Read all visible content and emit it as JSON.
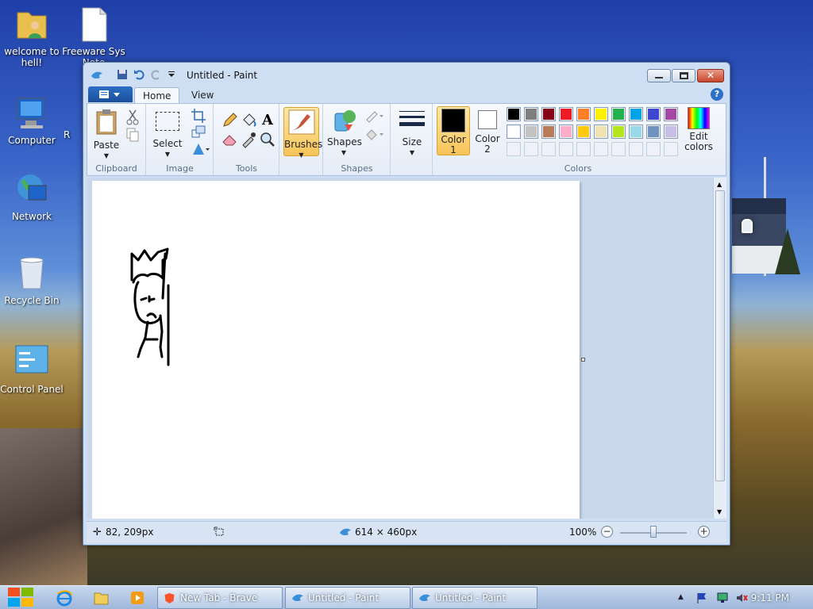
{
  "desktop": {
    "icons": [
      {
        "label": "welcome to hell!"
      },
      {
        "label": "Freeware Sys Note"
      },
      {
        "label": "Computer"
      },
      {
        "label": "R"
      },
      {
        "label": "Network"
      },
      {
        "label": "Recycle Bin"
      },
      {
        "label": "Control Panel"
      }
    ]
  },
  "window": {
    "title": "Untitled - Paint",
    "tabs": {
      "home": "Home",
      "view": "View"
    },
    "ribbon": {
      "clipboard": {
        "label": "Clipboard",
        "paste": "Paste"
      },
      "image": {
        "label": "Image",
        "select": "Select"
      },
      "tools": {
        "label": "Tools"
      },
      "brushes": "Brushes",
      "shapes": {
        "label": "Shapes",
        "button": "Shapes"
      },
      "size": "Size",
      "color1": {
        "line1": "Color",
        "line2": "1",
        "value": "#000000"
      },
      "color2": {
        "line1": "Color",
        "line2": "2",
        "value": "#ffffff"
      },
      "colors": {
        "label": "Colors",
        "edit_line1": "Edit",
        "edit_line2": "colors",
        "palette_row1": [
          "#000000",
          "#7f7f7f",
          "#880015",
          "#ed1c24",
          "#ff7f27",
          "#fff200",
          "#22b14c",
          "#00a2e8",
          "#3f48cc",
          "#a349a4"
        ],
        "palette_row2": [
          "#ffffff",
          "#c3c3c3",
          "#b97a57",
          "#ffaec9",
          "#ffc90e",
          "#efe4b0",
          "#b5e61d",
          "#99d9ea",
          "#7092be",
          "#c8bfe7"
        ]
      }
    },
    "status": {
      "cursor": "82, 209px",
      "size": "614 × 460px",
      "zoom": "100%"
    }
  },
  "taskbar": {
    "tasks": [
      {
        "label": "New Tab - Brave"
      },
      {
        "label": "Untitled - Paint"
      },
      {
        "label": "Untitled - Paint"
      }
    ],
    "clock": "9:11 PM"
  },
  "colors": {
    "accent": "#f7c458",
    "titlebar": "#cfdff3"
  }
}
